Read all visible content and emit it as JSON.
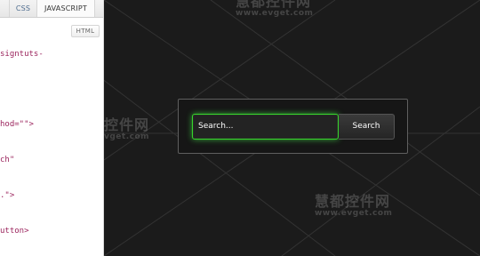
{
  "editor": {
    "tabs": [
      "",
      "CSS",
      "JAVASCRIPT"
    ],
    "html_button": "HTML",
    "code_lines": [
      "signtuts-",
      "",
      "hod=\"\">",
      "ch\"",
      ".\">",
      "utton>"
    ]
  },
  "preview": {
    "watermarks": [
      {
        "title": "慧都控件网",
        "url": "www.evget.com"
      },
      {
        "title": "控件网",
        "url": "vget.com"
      },
      {
        "title": "慧都控件网",
        "url": "www.evget.com"
      }
    ],
    "search": {
      "input_value": "Search...",
      "button_label": "Search"
    }
  }
}
